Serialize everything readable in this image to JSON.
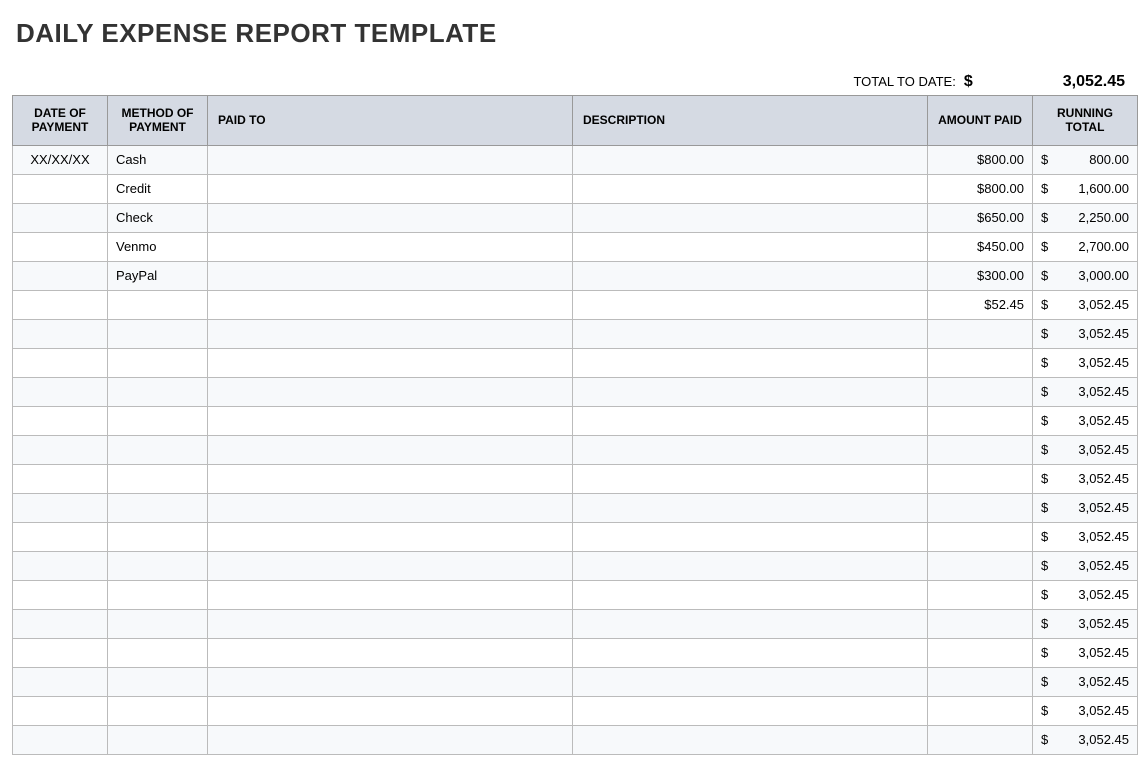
{
  "title": "DAILY EXPENSE REPORT TEMPLATE",
  "total_to_date_label": "TOTAL TO DATE:",
  "dollar_sign": "$",
  "total_to_date_value": "3,052.45",
  "headers": {
    "date": "DATE OF PAYMENT",
    "method": "METHOD OF PAYMENT",
    "paid_to": "PAID TO",
    "description": "DESCRIPTION",
    "amount": "AMOUNT PAID",
    "running": "RUNNING TOTAL"
  },
  "rows": [
    {
      "date": "XX/XX/XX",
      "method": "Cash",
      "paid_to": "",
      "description": "",
      "amount": "$800.00",
      "running": "800.00"
    },
    {
      "date": "",
      "method": "Credit",
      "paid_to": "",
      "description": "",
      "amount": "$800.00",
      "running": "1,600.00"
    },
    {
      "date": "",
      "method": "Check",
      "paid_to": "",
      "description": "",
      "amount": "$650.00",
      "running": "2,250.00"
    },
    {
      "date": "",
      "method": "Venmo",
      "paid_to": "",
      "description": "",
      "amount": "$450.00",
      "running": "2,700.00"
    },
    {
      "date": "",
      "method": "PayPal",
      "paid_to": "",
      "description": "",
      "amount": "$300.00",
      "running": "3,000.00"
    },
    {
      "date": "",
      "method": "",
      "paid_to": "",
      "description": "",
      "amount": "$52.45",
      "running": "3,052.45"
    },
    {
      "date": "",
      "method": "",
      "paid_to": "",
      "description": "",
      "amount": "",
      "running": "3,052.45"
    },
    {
      "date": "",
      "method": "",
      "paid_to": "",
      "description": "",
      "amount": "",
      "running": "3,052.45"
    },
    {
      "date": "",
      "method": "",
      "paid_to": "",
      "description": "",
      "amount": "",
      "running": "3,052.45"
    },
    {
      "date": "",
      "method": "",
      "paid_to": "",
      "description": "",
      "amount": "",
      "running": "3,052.45"
    },
    {
      "date": "",
      "method": "",
      "paid_to": "",
      "description": "",
      "amount": "",
      "running": "3,052.45"
    },
    {
      "date": "",
      "method": "",
      "paid_to": "",
      "description": "",
      "amount": "",
      "running": "3,052.45"
    },
    {
      "date": "",
      "method": "",
      "paid_to": "",
      "description": "",
      "amount": "",
      "running": "3,052.45"
    },
    {
      "date": "",
      "method": "",
      "paid_to": "",
      "description": "",
      "amount": "",
      "running": "3,052.45"
    },
    {
      "date": "",
      "method": "",
      "paid_to": "",
      "description": "",
      "amount": "",
      "running": "3,052.45"
    },
    {
      "date": "",
      "method": "",
      "paid_to": "",
      "description": "",
      "amount": "",
      "running": "3,052.45"
    },
    {
      "date": "",
      "method": "",
      "paid_to": "",
      "description": "",
      "amount": "",
      "running": "3,052.45"
    },
    {
      "date": "",
      "method": "",
      "paid_to": "",
      "description": "",
      "amount": "",
      "running": "3,052.45"
    },
    {
      "date": "",
      "method": "",
      "paid_to": "",
      "description": "",
      "amount": "",
      "running": "3,052.45"
    },
    {
      "date": "",
      "method": "",
      "paid_to": "",
      "description": "",
      "amount": "",
      "running": "3,052.45"
    },
    {
      "date": "",
      "method": "",
      "paid_to": "",
      "description": "",
      "amount": "",
      "running": "3,052.45"
    }
  ]
}
